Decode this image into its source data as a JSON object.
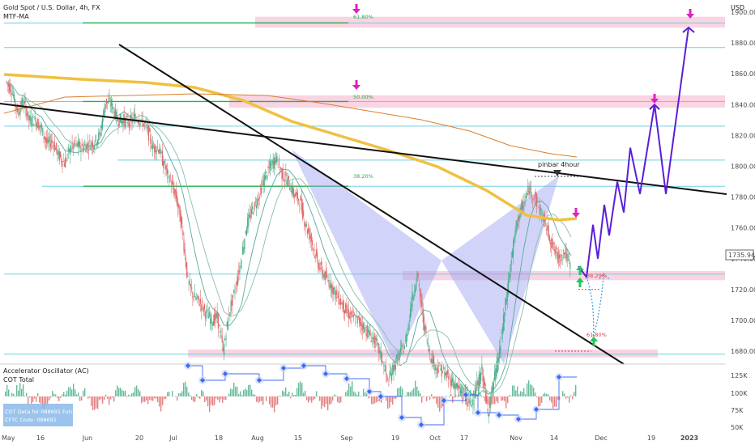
{
  "header": {
    "symbol_line": "Gold Spot / U.S. Dollar, 4h, FX",
    "indicator": "MTF-MA",
    "currency": "USD"
  },
  "last_price": "1735.94",
  "annotations": {
    "pinbar": "pinbar 4hour",
    "fib_618_top": "61.80%",
    "fib_500": "50.00%",
    "fib_382_left": "38.20%",
    "fib_382_right": "38.20%",
    "fib_618_bottom": "61.80%"
  },
  "lower_panel": {
    "title": "Accelerator Oscillator (AC)",
    "cot_total": "COT Total",
    "cot_box_line1": "COT Data for 088691 Futures",
    "cot_box_line2": "CFTC Code: 088691",
    "y_ticks": [
      "125K",
      "100K",
      "75K",
      "50K"
    ]
  },
  "colors": {
    "trendline": "#111111",
    "forecast": "#5b1ed6",
    "pattern_fill": "#9aa0f0",
    "zone_pink": "#f7c6d9",
    "fib_green": "#22b14c",
    "ma_yellow": "#f0c040",
    "ma_orange": "#d9802c",
    "candle_up": "#4caf8a",
    "candle_down": "#e06b6b",
    "cyan_level": "#6fcfe0",
    "marker_magenta": "#e020c0",
    "marker_green": "#22c55e",
    "cot_blue": "#3b6cf0",
    "cot_box": "#8ab8e8"
  },
  "chart_data": {
    "type": "line",
    "title": "Gold Spot / U.S. Dollar, 4h, FX",
    "xlabel": "",
    "ylabel": "USD",
    "ylim": [
      1670,
      1900
    ],
    "y_ticks": [
      1680,
      1700,
      1720,
      1740,
      1760,
      1780,
      1800,
      1820,
      1840,
      1860,
      1880,
      1900
    ],
    "x_tick_labels": [
      "May",
      "16",
      "Jun",
      "20",
      "Jul",
      "18",
      "Aug",
      "15",
      "Sep",
      "19",
      "Oct",
      "17",
      "Nov",
      "14",
      "Dec",
      "19",
      "2023"
    ],
    "series": [
      {
        "values": [
          1855,
          1850,
          1835,
          1842,
          1830,
          1830,
          1825,
          1815,
          1816,
          1807,
          1802,
          1812,
          1814,
          1812,
          1814,
          1815,
          1820,
          1842,
          1840,
          1830,
          1830,
          1828,
          1832,
          1830,
          1825,
          1812,
          1812,
          1800,
          1790,
          1780,
          1760,
          1725,
          1715,
          1712,
          1705,
          1700,
          1702,
          1680,
          1705,
          1720,
          1738,
          1762,
          1772,
          1780,
          1792,
          1800,
          1805,
          1795,
          1790,
          1782,
          1778,
          1762,
          1752,
          1738,
          1730,
          1725,
          1718,
          1712,
          1705,
          1702,
          1700,
          1695,
          1690,
          1685,
          1675,
          1660,
          1670,
          1678,
          1685,
          1712,
          1730,
          1700,
          1680,
          1670,
          1668,
          1664,
          1660,
          1655,
          1650,
          1645,
          1655,
          1668,
          1640,
          1660,
          1680,
          1710,
          1740,
          1765,
          1775,
          1785,
          1780,
          1770,
          1760,
          1748,
          1740,
          1745,
          1735
        ]
      },
      {
        "name": "forecast",
        "values": [
          1735,
          1728,
          1762,
          1740,
          1775,
          1755,
          1790,
          1770,
          1812,
          1782,
          1840,
          1782,
          1890
        ]
      }
    ],
    "horizontal_levels": [
      1893,
      1877,
      1842,
      1826,
      1804,
      1787,
      1730,
      1678
    ],
    "zones": [
      [
        1890,
        1897
      ],
      [
        1838,
        1846
      ],
      [
        1726,
        1732
      ],
      [
        1676,
        1681
      ]
    ],
    "fibonacci": [
      {
        "label": "61.80%",
        "price": 1893
      },
      {
        "label": "50.00%",
        "price": 1842
      },
      {
        "label": "38.20%",
        "price": 1787
      },
      {
        "label": "38.20%",
        "price": 1720
      },
      {
        "label": "61.80%",
        "price": 1680
      }
    ]
  }
}
